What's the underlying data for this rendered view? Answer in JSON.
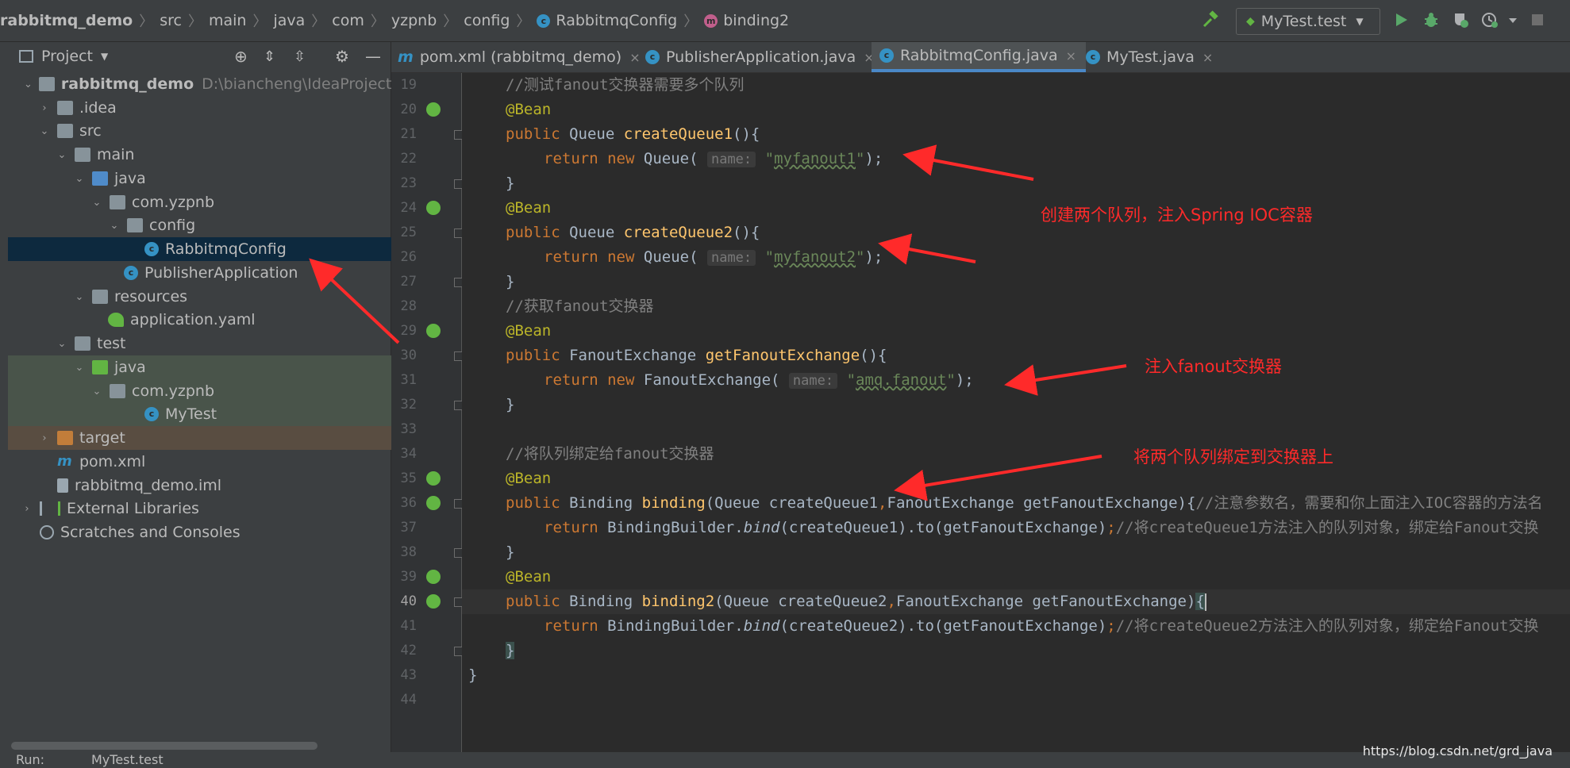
{
  "breadcrumbs": {
    "items": [
      "rabbitmq_demo",
      "src",
      "main",
      "java",
      "com",
      "yzpnb",
      "config",
      "RabbitmqConfig",
      "binding2"
    ],
    "class_icon_letter": "c",
    "method_icon_letter": "m"
  },
  "toolbar": {
    "run_config_label": "MyTest.test",
    "icons": [
      "build-hammer-icon",
      "run-icon",
      "debug-icon",
      "coverage-icon",
      "profile-icon",
      "more-dropdown-icon",
      "stop-icon"
    ]
  },
  "project_panel": {
    "title": "Project",
    "tree": [
      {
        "label": "rabbitmq_demo",
        "path": "D:\\biancheng\\IdeaProjects\\rabb",
        "icon": "module-folder-icon"
      },
      {
        "label": ".idea",
        "icon": "folder-icon"
      },
      {
        "label": "src",
        "icon": "folder-icon"
      },
      {
        "label": "main",
        "icon": "folder-icon"
      },
      {
        "label": "java",
        "icon": "source-folder-icon"
      },
      {
        "label": "com.yzpnb",
        "icon": "package-icon"
      },
      {
        "label": "config",
        "icon": "package-icon"
      },
      {
        "label": "RabbitmqConfig",
        "icon": "class-icon"
      },
      {
        "label": "PublisherApplication",
        "icon": "spring-boot-class-icon"
      },
      {
        "label": "resources",
        "icon": "resources-folder-icon"
      },
      {
        "label": "application.yaml",
        "icon": "yaml-icon"
      },
      {
        "label": "test",
        "icon": "folder-icon"
      },
      {
        "label": "java",
        "icon": "test-source-folder-icon"
      },
      {
        "label": "com.yzpnb",
        "icon": "package-icon"
      },
      {
        "label": "MyTest",
        "icon": "test-class-icon"
      },
      {
        "label": "target",
        "icon": "excluded-folder-icon"
      },
      {
        "label": "pom.xml",
        "icon": "maven-icon"
      },
      {
        "label": "rabbitmq_demo.iml",
        "icon": "iml-file-icon"
      },
      {
        "label": "External Libraries",
        "icon": "libraries-icon"
      },
      {
        "label": "Scratches and Consoles",
        "icon": "scratches-icon"
      }
    ],
    "class_letter": "c"
  },
  "tabs": [
    {
      "label": "pom.xml (rabbitmq_demo)",
      "icon": "maven-icon",
      "active": false
    },
    {
      "label": "PublisherApplication.java",
      "icon": "class-icon",
      "active": false
    },
    {
      "label": "RabbitmqConfig.java",
      "icon": "class-icon",
      "active": true
    },
    {
      "label": "MyTest.java",
      "icon": "test-class-icon",
      "active": false
    }
  ],
  "tab_close_glyph": "×",
  "editor": {
    "line_numbers": [
      "19",
      "20",
      "21",
      "22",
      "23",
      "24",
      "25",
      "26",
      "27",
      "28",
      "29",
      "30",
      "31",
      "32",
      "33",
      "34",
      "35",
      "36",
      "37",
      "38",
      "39",
      "40",
      "41",
      "42",
      "43",
      "44"
    ],
    "param_hint": "name:",
    "code": {
      "l19_comment": "//测试fanout交换器需要多个队列",
      "bean": "@Bean",
      "public": "public",
      "return": "return",
      "new": "new",
      "queue_type": "Queue",
      "create_queue1": "createQueue1",
      "create_queue2": "createQueue2",
      "parens_open": "(){",
      "close_brace": "}",
      "queue_ctor": "Queue(",
      "myfanout1": "myfanout1",
      "myfanout2": "myfanout2",
      "quote": "\"",
      "end_stmt": ");",
      "l28_comment": "//获取fanout交换器",
      "fanout_type": "FanoutExchange",
      "get_fanout": "getFanoutExchange",
      "fanout_ctor": "FanoutExchange(",
      "amq_fanout": "amq.fanout",
      "l34_comment": "//将队列绑定给fanout交换器",
      "binding_type": "Binding",
      "binding": "binding",
      "binding2": "binding2",
      "sig1_a": "(Queue createQueue1",
      "sig2_a": "(Queue createQueue2",
      "comma": ",",
      "sig_b": "FanoutExchange getFanoutExchange){",
      "sig_b2": "FanoutExchange getFanoutExchange)",
      "open_brace": "{",
      "l36_comment": "//注意参数名，需要和你上面注入IOC容器的方法名",
      "builder": "BindingBuilder.",
      "bind": "bind",
      "bind_args1": "(createQueue1).to(getFanoutExchange)",
      "bind_args2": "(createQueue2).to(getFanoutExchange)",
      "semicolon": ";",
      "l37_comment": "//将createQueue1方法注入的队列对象，绑定给Fanout交换",
      "l41_comment": "//将createQueue2方法注入的队列对象，绑定给Fanout交换"
    }
  },
  "annotations": {
    "queues": "创建两个队列，注入Spring IOC容器",
    "fanout": "注入fanout交换器",
    "binding": "将两个队列绑定到交换器上",
    "color": "#ff2a2a"
  },
  "status": {
    "run_label": "Run:",
    "run_target": "MyTest.test"
  },
  "watermark": "https://blog.csdn.net/grd_java"
}
